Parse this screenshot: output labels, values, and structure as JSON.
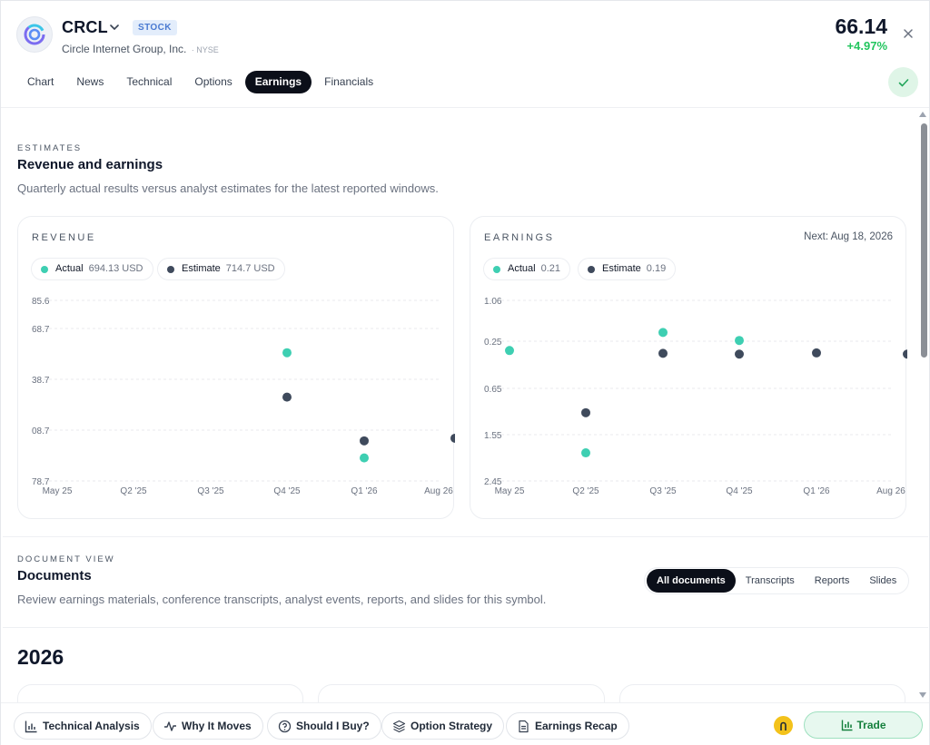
{
  "header": {
    "ticker": "CRCL",
    "badge": "STOCK",
    "company": "Circle Internet Group, Inc.",
    "exchange": "· NYSE",
    "price": "66.14",
    "change": "+4.97%"
  },
  "tabs": [
    {
      "label": "Chart",
      "active": false
    },
    {
      "label": "News",
      "active": false
    },
    {
      "label": "Technical",
      "active": false
    },
    {
      "label": "Options",
      "active": false
    },
    {
      "label": "Earnings",
      "active": true
    },
    {
      "label": "Financials",
      "active": false
    }
  ],
  "estimates": {
    "kicker": "ESTIMATES",
    "title": "Revenue and earnings",
    "description": "Quarterly actual results versus analyst estimates for the latest reported windows."
  },
  "revenue_card": {
    "kicker": "REVENUE",
    "actual_label": "Actual",
    "actual_value": "694.13 USD",
    "estimate_label": "Estimate",
    "estimate_value": "714.7 USD"
  },
  "earnings_card": {
    "kicker": "EARNINGS",
    "next": "Next: Aug 18, 2026",
    "actual_label": "Actual",
    "actual_value": "0.21",
    "estimate_label": "Estimate",
    "estimate_value": "0.19"
  },
  "colors": {
    "actual": "#3ecfb2",
    "estimate": "#3f4a5c"
  },
  "chart_data": [
    {
      "type": "scatter",
      "title": "REVENUE",
      "categories": [
        "May 25",
        "Q2 '25",
        "Q3 '25",
        "Q4 '25",
        "Q1 '26",
        "Aug 26"
      ],
      "y_tick_labels": [
        "85.6",
        "68.7",
        "38.7",
        "08.7",
        "78.7"
      ],
      "series": [
        {
          "name": "Actual",
          "values": [
            null,
            null,
            null,
            74.1,
            5.1,
            null
          ]
        },
        {
          "name": "Estimate",
          "values": [
            null,
            null,
            null,
            45.0,
            16.3,
            18.0
          ]
        }
      ],
      "legend": "top-left",
      "grid": true
    },
    {
      "type": "scatter",
      "title": "EARNINGS",
      "categories": [
        "May 25",
        "Q2 '25",
        "Q3 '25",
        "Q4 '25",
        "Q1 '26",
        "Aug 26"
      ],
      "y_tick_labels": [
        "1.06",
        "0.25",
        "0.65",
        "1.55",
        "2.45"
      ],
      "series": [
        {
          "name": "Actual",
          "values": [
            0.25,
            -2.3,
            0.7,
            0.5,
            null,
            null
          ]
        },
        {
          "name": "Estimate",
          "values": [
            null,
            -1.3,
            0.18,
            0.16,
            0.19,
            0.16
          ]
        }
      ],
      "legend": "top-left",
      "grid": true
    }
  ],
  "documents": {
    "kicker": "DOCUMENT VIEW",
    "title": "Documents",
    "description": "Review earnings materials, conference transcripts, analyst events, reports, and slides for this symbol.",
    "filters": [
      {
        "label": "All documents",
        "active": true
      },
      {
        "label": "Transcripts",
        "active": false
      },
      {
        "label": "Reports",
        "active": false
      },
      {
        "label": "Slides",
        "active": false
      }
    ],
    "year": "2026"
  },
  "bottom_bar": {
    "buttons": [
      {
        "label": "Technical Analysis",
        "icon": "bar-chart-icon"
      },
      {
        "label": "Why It Moves",
        "icon": "activity-icon"
      },
      {
        "label": "Should I Buy?",
        "icon": "question-icon"
      },
      {
        "label": "Option Strategy",
        "icon": "layers-icon"
      },
      {
        "label": "Earnings Recap",
        "icon": "document-icon"
      }
    ],
    "trade_label": "Trade"
  }
}
